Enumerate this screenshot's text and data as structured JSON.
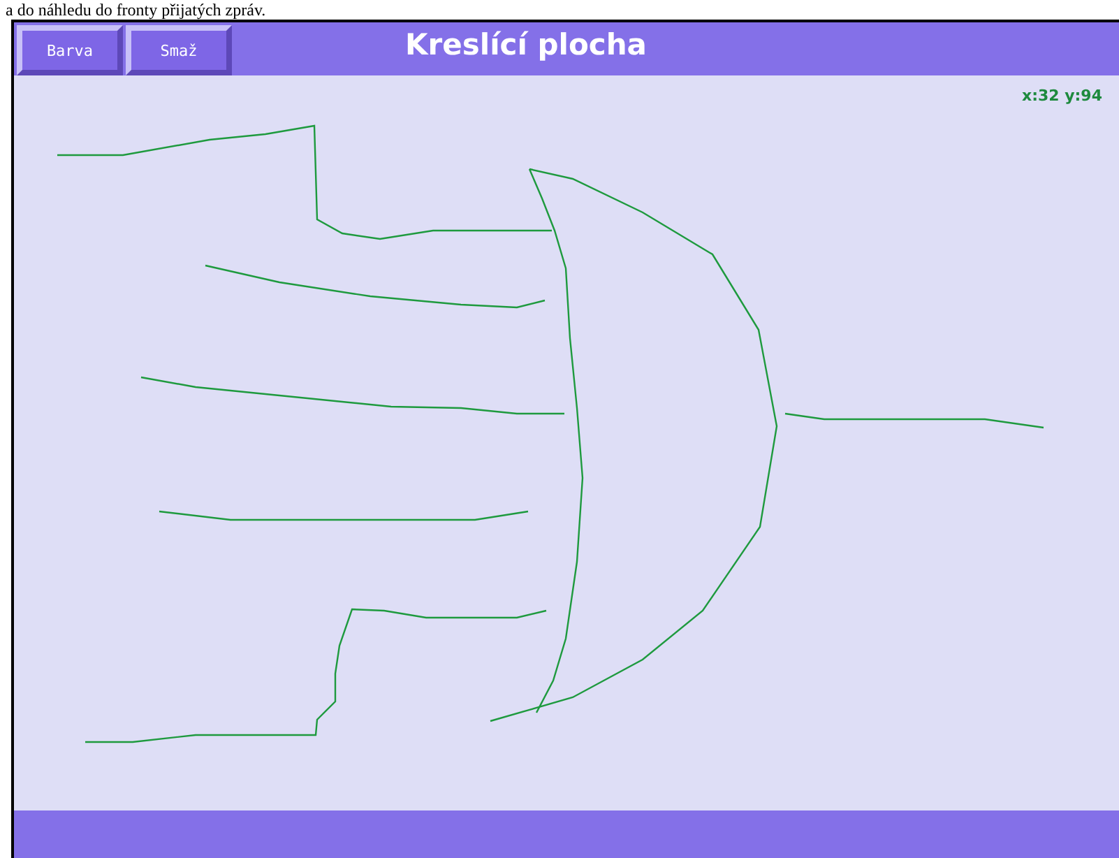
{
  "caption": "a do náhledu do fronty přijatých zpráv.",
  "window": {
    "title": "Kreslící plocha"
  },
  "buttons": [
    {
      "label": "Barva"
    },
    {
      "label": "Smaž"
    }
  ],
  "cursor_position": "x:32 y:94"
}
